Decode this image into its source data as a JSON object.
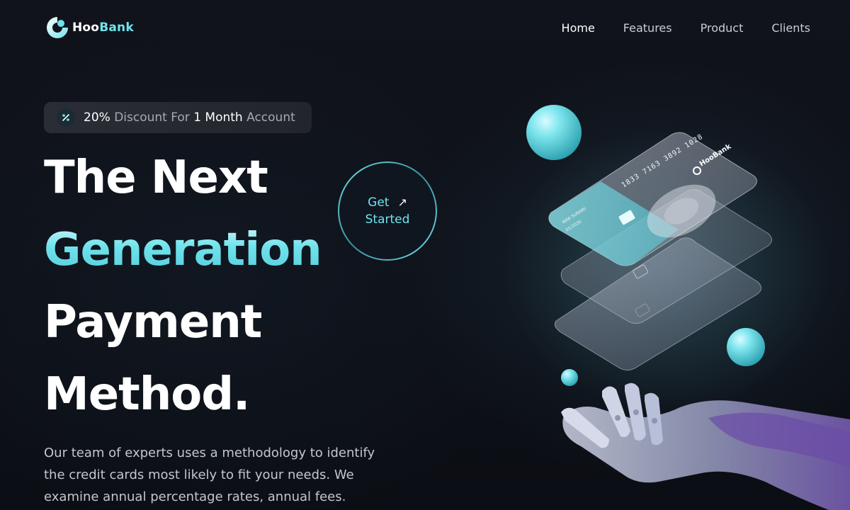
{
  "brand": {
    "name_part1": "Hoo",
    "name_part2": "Bank",
    "card_number": "1833 7163 3892 1028",
    "card_holder": "WAK SUNARI",
    "card_sub": "05/2026"
  },
  "nav": {
    "items": [
      {
        "label": "Home",
        "active": true
      },
      {
        "label": "Features",
        "active": false
      },
      {
        "label": "Product",
        "active": false
      },
      {
        "label": "Clients",
        "active": false
      }
    ]
  },
  "promo": {
    "percent": "20%",
    "text_mid": " Discount For ",
    "duration": "1 Month",
    "text_end": " Account"
  },
  "headline": {
    "line1": "The Next",
    "line2": "Generation",
    "line3": "Payment",
    "line4": "Method."
  },
  "cta": {
    "line1": "Get",
    "line2": "Started",
    "arrow": "↗"
  },
  "intro": {
    "text": "Our team of experts uses a methodology to identify the credit cards most likely to fit your needs. We examine annual percentage rates, annual fees."
  },
  "colors": {
    "accent": "#6fe3ec",
    "background": "#0d1017"
  },
  "icons": {
    "promo": "discount-icon",
    "cta": "arrow-up-right-icon",
    "logo": "hoobank-logo-icon"
  }
}
